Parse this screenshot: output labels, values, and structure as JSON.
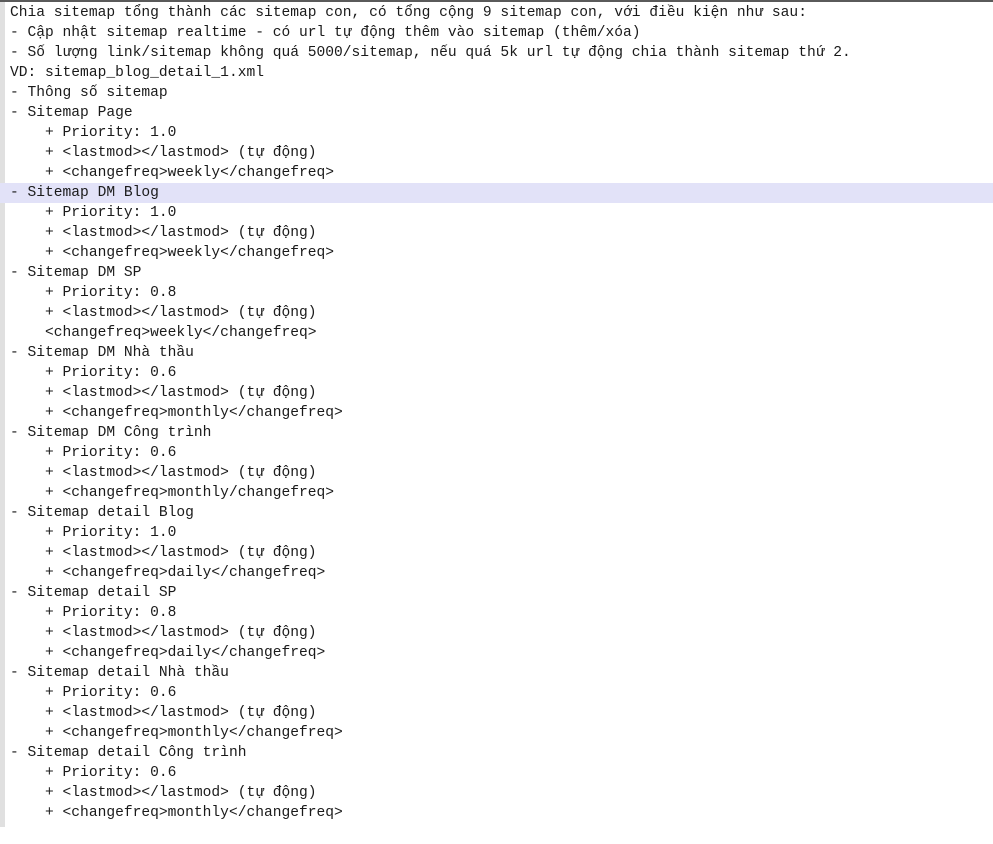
{
  "document": {
    "kind": "plain-text-note",
    "highlighted_line_index": 9,
    "colors": {
      "background": "#ffffff",
      "text": "#1a1a1a",
      "gutter": "#e0e0e0",
      "top_border": "#5a5a5a",
      "selection_highlight": "#e2e2f8"
    },
    "lines": [
      "Chia sitemap tổng thành các sitemap con, có tổng cộng 9 sitemap con, với điều kiện như sau:",
      "- Cập nhật sitemap realtime - có url tự động thêm vào sitemap (thêm/xóa)",
      "- Số lượng link/sitemap không quá 5000/sitemap, nếu quá 5k url tự động chia thành sitemap thứ 2.",
      "VD: sitemap_blog_detail_1.xml",
      "- Thông số sitemap",
      "- Sitemap Page",
      "    + Priority: 1.0",
      "    + <lastmod></lastmod> (tự động)",
      "    + <changefreq>weekly</changefreq>",
      "- Sitemap DM Blog",
      "    + Priority: 1.0",
      "    + <lastmod></lastmod> (tự động)",
      "    + <changefreq>weekly</changefreq>",
      "- Sitemap DM SP",
      "    + Priority: 0.8",
      "    + <lastmod></lastmod> (tự động)",
      "    <changefreq>weekly</changefreq>",
      "- Sitemap DM Nhà thầu",
      "    + Priority: 0.6",
      "    + <lastmod></lastmod> (tự động)",
      "    + <changefreq>monthly</changefreq>",
      "- Sitemap DM Công trình",
      "    + Priority: 0.6",
      "    + <lastmod></lastmod> (tự động)",
      "    + <changefreq>monthly/changefreq>",
      "- Sitemap detail Blog",
      "    + Priority: 1.0",
      "    + <lastmod></lastmod> (tự động)",
      "    + <changefreq>daily</changefreq>",
      "- Sitemap detail SP",
      "    + Priority: 0.8",
      "    + <lastmod></lastmod> (tự động)",
      "    + <changefreq>daily</changefreq>",
      "- Sitemap detail Nhà thầu",
      "    + Priority: 0.6",
      "    + <lastmod></lastmod> (tự động)",
      "    + <changefreq>monthly</changefreq>",
      "- Sitemap detail Công trình",
      "    + Priority: 0.6",
      "    + <lastmod></lastmod> (tự động)",
      "    + <changefreq>monthly</changefreq>"
    ]
  }
}
